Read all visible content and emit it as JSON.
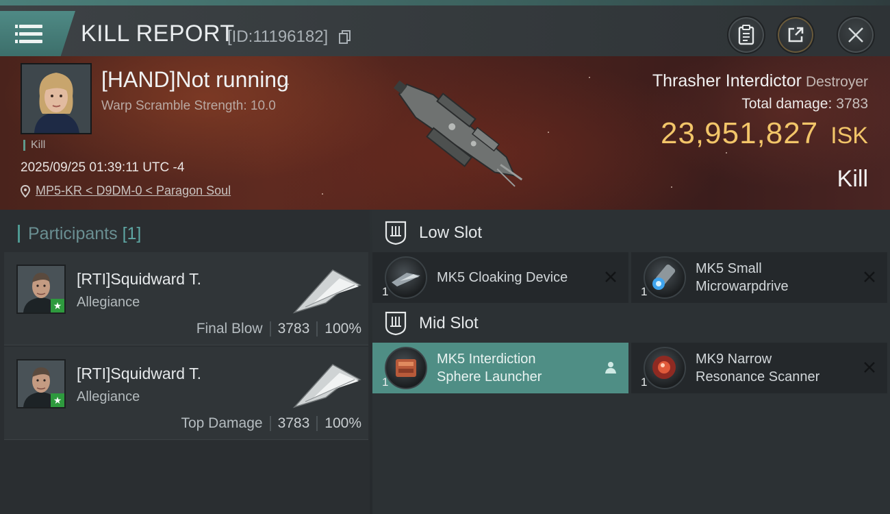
{
  "header": {
    "title": "KILL REPORT",
    "report_id": "[ID:11196182]"
  },
  "victim": {
    "name": "[HAND]Not running",
    "subtitle": "Warp Scramble Strength: 10.0",
    "tag": "Kill",
    "timestamp": "2025/09/25 01:39:11 UTC -4",
    "location": "MP5-KR < D9DM-0 < Paragon Soul",
    "ship_name": "Thrasher Interdictor",
    "ship_class": "Destroyer",
    "total_damage_label": "Total damage:",
    "total_damage": "3783",
    "isk_value": "23,951,827",
    "isk_unit": "ISK",
    "kill_type": "Kill"
  },
  "participants": {
    "label": "Participants",
    "count": "[1]",
    "items": [
      {
        "name": "[RTI]Squidward T.",
        "corp": "Allegiance",
        "role": "Final Blow",
        "damage": "3783",
        "percent": "100%"
      },
      {
        "name": "[RTI]Squidward T.",
        "corp": "Allegiance",
        "role": "Top Damage",
        "damage": "3783",
        "percent": "100%"
      }
    ]
  },
  "slots": {
    "low": {
      "label": "Low Slot",
      "modules": [
        {
          "qty": "1",
          "line1": "MK5 Cloaking Device",
          "line2": "",
          "status": "destroyed"
        },
        {
          "qty": "1",
          "line1": "MK5 Small",
          "line2": "Microwarpdrive",
          "status": "destroyed"
        }
      ]
    },
    "mid": {
      "label": "Mid Slot",
      "modules": [
        {
          "qty": "1",
          "line1": "MK5 Interdiction",
          "line2": "Sphere Launcher",
          "status": "dropped"
        },
        {
          "qty": "1",
          "line1": "MK9 Narrow",
          "line2": "Resonance Scanner",
          "status": "destroyed"
        }
      ]
    }
  },
  "icons": {
    "menu": "menu-icon",
    "copy": "copy-icon",
    "clipboard": "clipboard-icon",
    "share": "share-icon",
    "close": "close-icon",
    "location": "location-pin-icon"
  },
  "colors": {
    "accent": "#4f8e85",
    "isk": "#f2c569",
    "highlight_module": "#4f8e85"
  }
}
